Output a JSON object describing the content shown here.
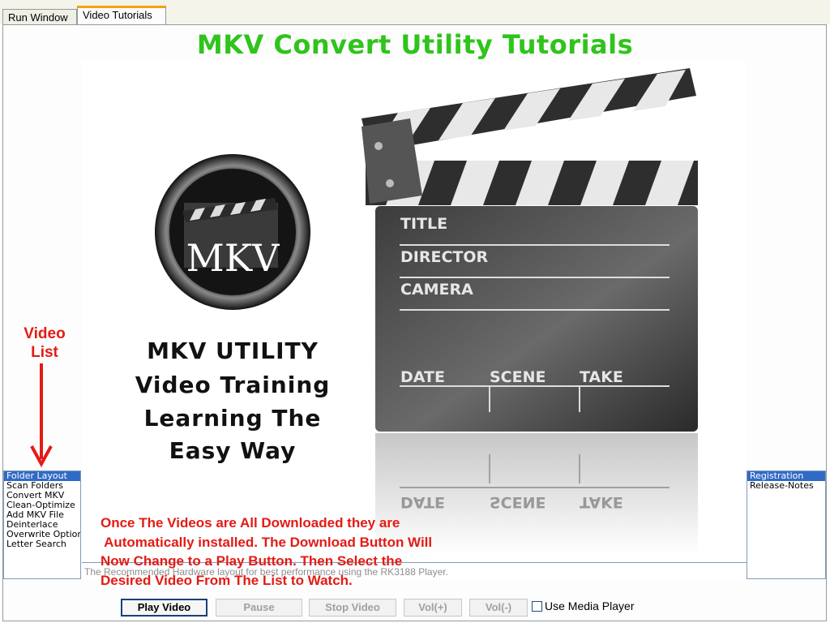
{
  "tabs": [
    {
      "label": "Run Window",
      "active": false
    },
    {
      "label": "Video Tutorials",
      "active": true
    }
  ],
  "heading": "MKV Convert Utility Tutorials",
  "video_list_label": [
    "Video",
    "List"
  ],
  "video_list": {
    "items": [
      "Folder Layout",
      "Scan Folders",
      "Convert MKV",
      "Clean-Optimize",
      "Add MKV File",
      "Deinterlace",
      "Overwrite Option",
      "Letter Search"
    ],
    "selected": "Folder Layout"
  },
  "doc_list": {
    "items": [
      "Registration",
      "Release-Notes"
    ],
    "selected": "Registration"
  },
  "poster": {
    "logo_text": "MKV",
    "lines": [
      "MKV UTILITY",
      "Video Training",
      "Learning The",
      "Easy Way"
    ],
    "clapper_fields": [
      "TITLE",
      "DIRECTOR",
      "CAMERA"
    ],
    "clapper_bottom": [
      "DATE",
      "SCENE",
      "TAKE"
    ]
  },
  "description": "The Recommended Hardware layout for best performance using the RK3188 Player.",
  "instruction": [
    "Once The Videos are All Downloaded they are",
    " Automatically installed. The Download Button Will",
    "Now Change to a Play Button. Then Select the",
    "Desired Video From The List to Watch."
  ],
  "buttons": [
    {
      "label": "Play Video",
      "enabled": true
    },
    {
      "label": "Pause",
      "enabled": false
    },
    {
      "label": "Stop Video",
      "enabled": false
    },
    {
      "label": "Vol(+)",
      "enabled": false
    },
    {
      "label": "Vol(-)",
      "enabled": false
    }
  ],
  "use_media_player": {
    "label": "Use Media Player",
    "checked": false
  },
  "colors": {
    "heading": "#2fc41c",
    "annotation": "#e31b14",
    "selection": "#316ac5"
  }
}
